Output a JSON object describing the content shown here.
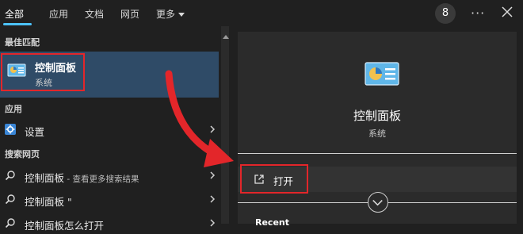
{
  "topbar": {
    "tabs": [
      {
        "label": "全部",
        "active": true
      },
      {
        "label": "应用",
        "active": false
      },
      {
        "label": "文档",
        "active": false
      },
      {
        "label": "网页",
        "active": false
      },
      {
        "label": "更多",
        "active": false
      }
    ],
    "badge": "8",
    "more_glyph": "···"
  },
  "left": {
    "best_match_header": "最佳匹配",
    "best_match": {
      "title": "控制面板",
      "subtitle": "系统",
      "icon": "control-panel-icon"
    },
    "apps_header": "应用",
    "apps": [
      {
        "label": "设置",
        "icon": "settings-gear-icon"
      }
    ],
    "web_header": "搜索网页",
    "web": [
      {
        "label": "控制面板",
        "suffix": " - 查看更多搜索结果"
      },
      {
        "label": "控制面板 \"",
        "suffix": ""
      },
      {
        "label": "控制面板怎么打开",
        "suffix": ""
      }
    ]
  },
  "right": {
    "title": "控制面板",
    "subtitle": "系统",
    "open_label": "打开",
    "recent_header": "Recent"
  },
  "colors": {
    "accent": "#4cc2ff",
    "highlight": "#2f4b67",
    "annotation_red": "#e3262a",
    "background": "#202020",
    "panel": "#2b2b2b"
  }
}
